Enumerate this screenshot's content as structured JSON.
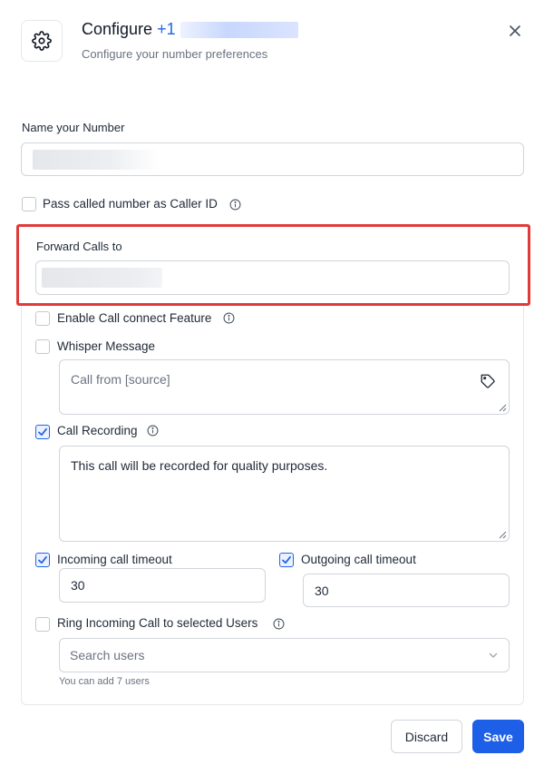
{
  "header": {
    "title": "Configure",
    "number_prefix": "+1",
    "subtitle": "Configure your number preferences"
  },
  "name_section": {
    "label": "Name your Number",
    "value": ""
  },
  "pass_caller_id": {
    "label": "Pass called number as Caller ID",
    "checked": false
  },
  "forward": {
    "label": "Forward Calls to",
    "value": ""
  },
  "call_connect": {
    "label": "Enable Call connect Feature",
    "checked": false
  },
  "whisper": {
    "label": "Whisper Message",
    "checked": false,
    "placeholder": "Call from [source]"
  },
  "recording": {
    "label": "Call Recording",
    "checked": true,
    "message": "This call will be recorded for quality purposes."
  },
  "incoming_timeout": {
    "label": "Incoming call timeout",
    "checked": true,
    "value": "30"
  },
  "outgoing_timeout": {
    "label": "Outgoing call timeout",
    "checked": true,
    "value": "30"
  },
  "ring_users": {
    "label": "Ring Incoming Call to selected Users",
    "checked": false,
    "placeholder": "Search users",
    "hint": "You can add 7 users"
  },
  "footer": {
    "discard_label": "Discard",
    "save_label": "Save"
  },
  "colors": {
    "accent": "#1d5fe6",
    "highlight_border": "#e03a3a"
  },
  "icons": {
    "settings": "gear-icon",
    "close": "close-icon",
    "info": "info-icon",
    "tag": "tag-icon",
    "dropdown": "chevron-down-icon"
  }
}
